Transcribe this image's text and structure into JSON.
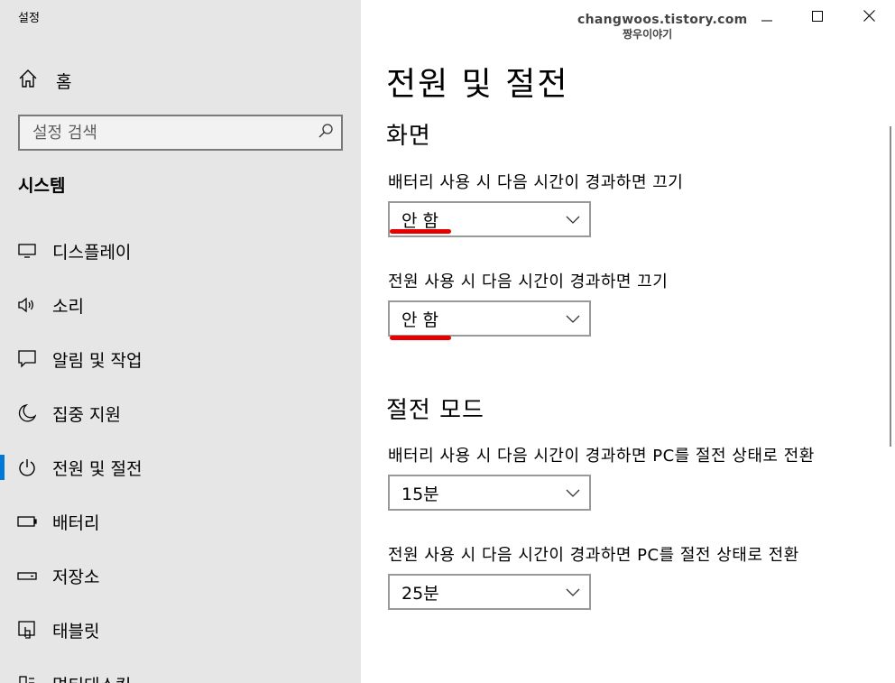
{
  "window": {
    "title": "설정",
    "watermark_line1": "changwoos.tistory.com",
    "watermark_line2": "짱우이야기"
  },
  "sidebar": {
    "home_label": "홈",
    "search_placeholder": "설정 검색",
    "section_title": "시스템",
    "items": [
      {
        "label": "디스플레이",
        "icon": "display-icon"
      },
      {
        "label": "소리",
        "icon": "speaker-icon"
      },
      {
        "label": "알림 및 작업",
        "icon": "notification-icon"
      },
      {
        "label": "집중 지원",
        "icon": "moon-icon"
      },
      {
        "label": "전원 및 절전",
        "icon": "power-icon",
        "selected": true
      },
      {
        "label": "배터리",
        "icon": "battery-icon"
      },
      {
        "label": "저장소",
        "icon": "storage-icon"
      },
      {
        "label": "태블릿",
        "icon": "tablet-icon"
      },
      {
        "label": "멀티태스킹",
        "icon": "multitasking-icon"
      }
    ]
  },
  "main": {
    "page_title": "전원 및 절전",
    "screen": {
      "heading": "화면",
      "battery_label": "배터리 사용 시 다음 시간이 경과하면 끄기",
      "battery_value": "안 함",
      "power_label": "전원 사용 시 다음 시간이 경과하면 끄기",
      "power_value": "안 함"
    },
    "sleep": {
      "heading": "절전 모드",
      "battery_label": "배터리 사용 시 다음 시간이 경과하면 PC를 절전 상태로 전환",
      "battery_value": "15분",
      "power_label": "전원 사용 시 다음 시간이 경과하면 PC를 절전 상태로 전환",
      "power_value": "25분"
    }
  },
  "colors": {
    "accent": "#0078d7",
    "sidebar_bg": "#e6e6e6",
    "annotation_red": "#e60000"
  }
}
